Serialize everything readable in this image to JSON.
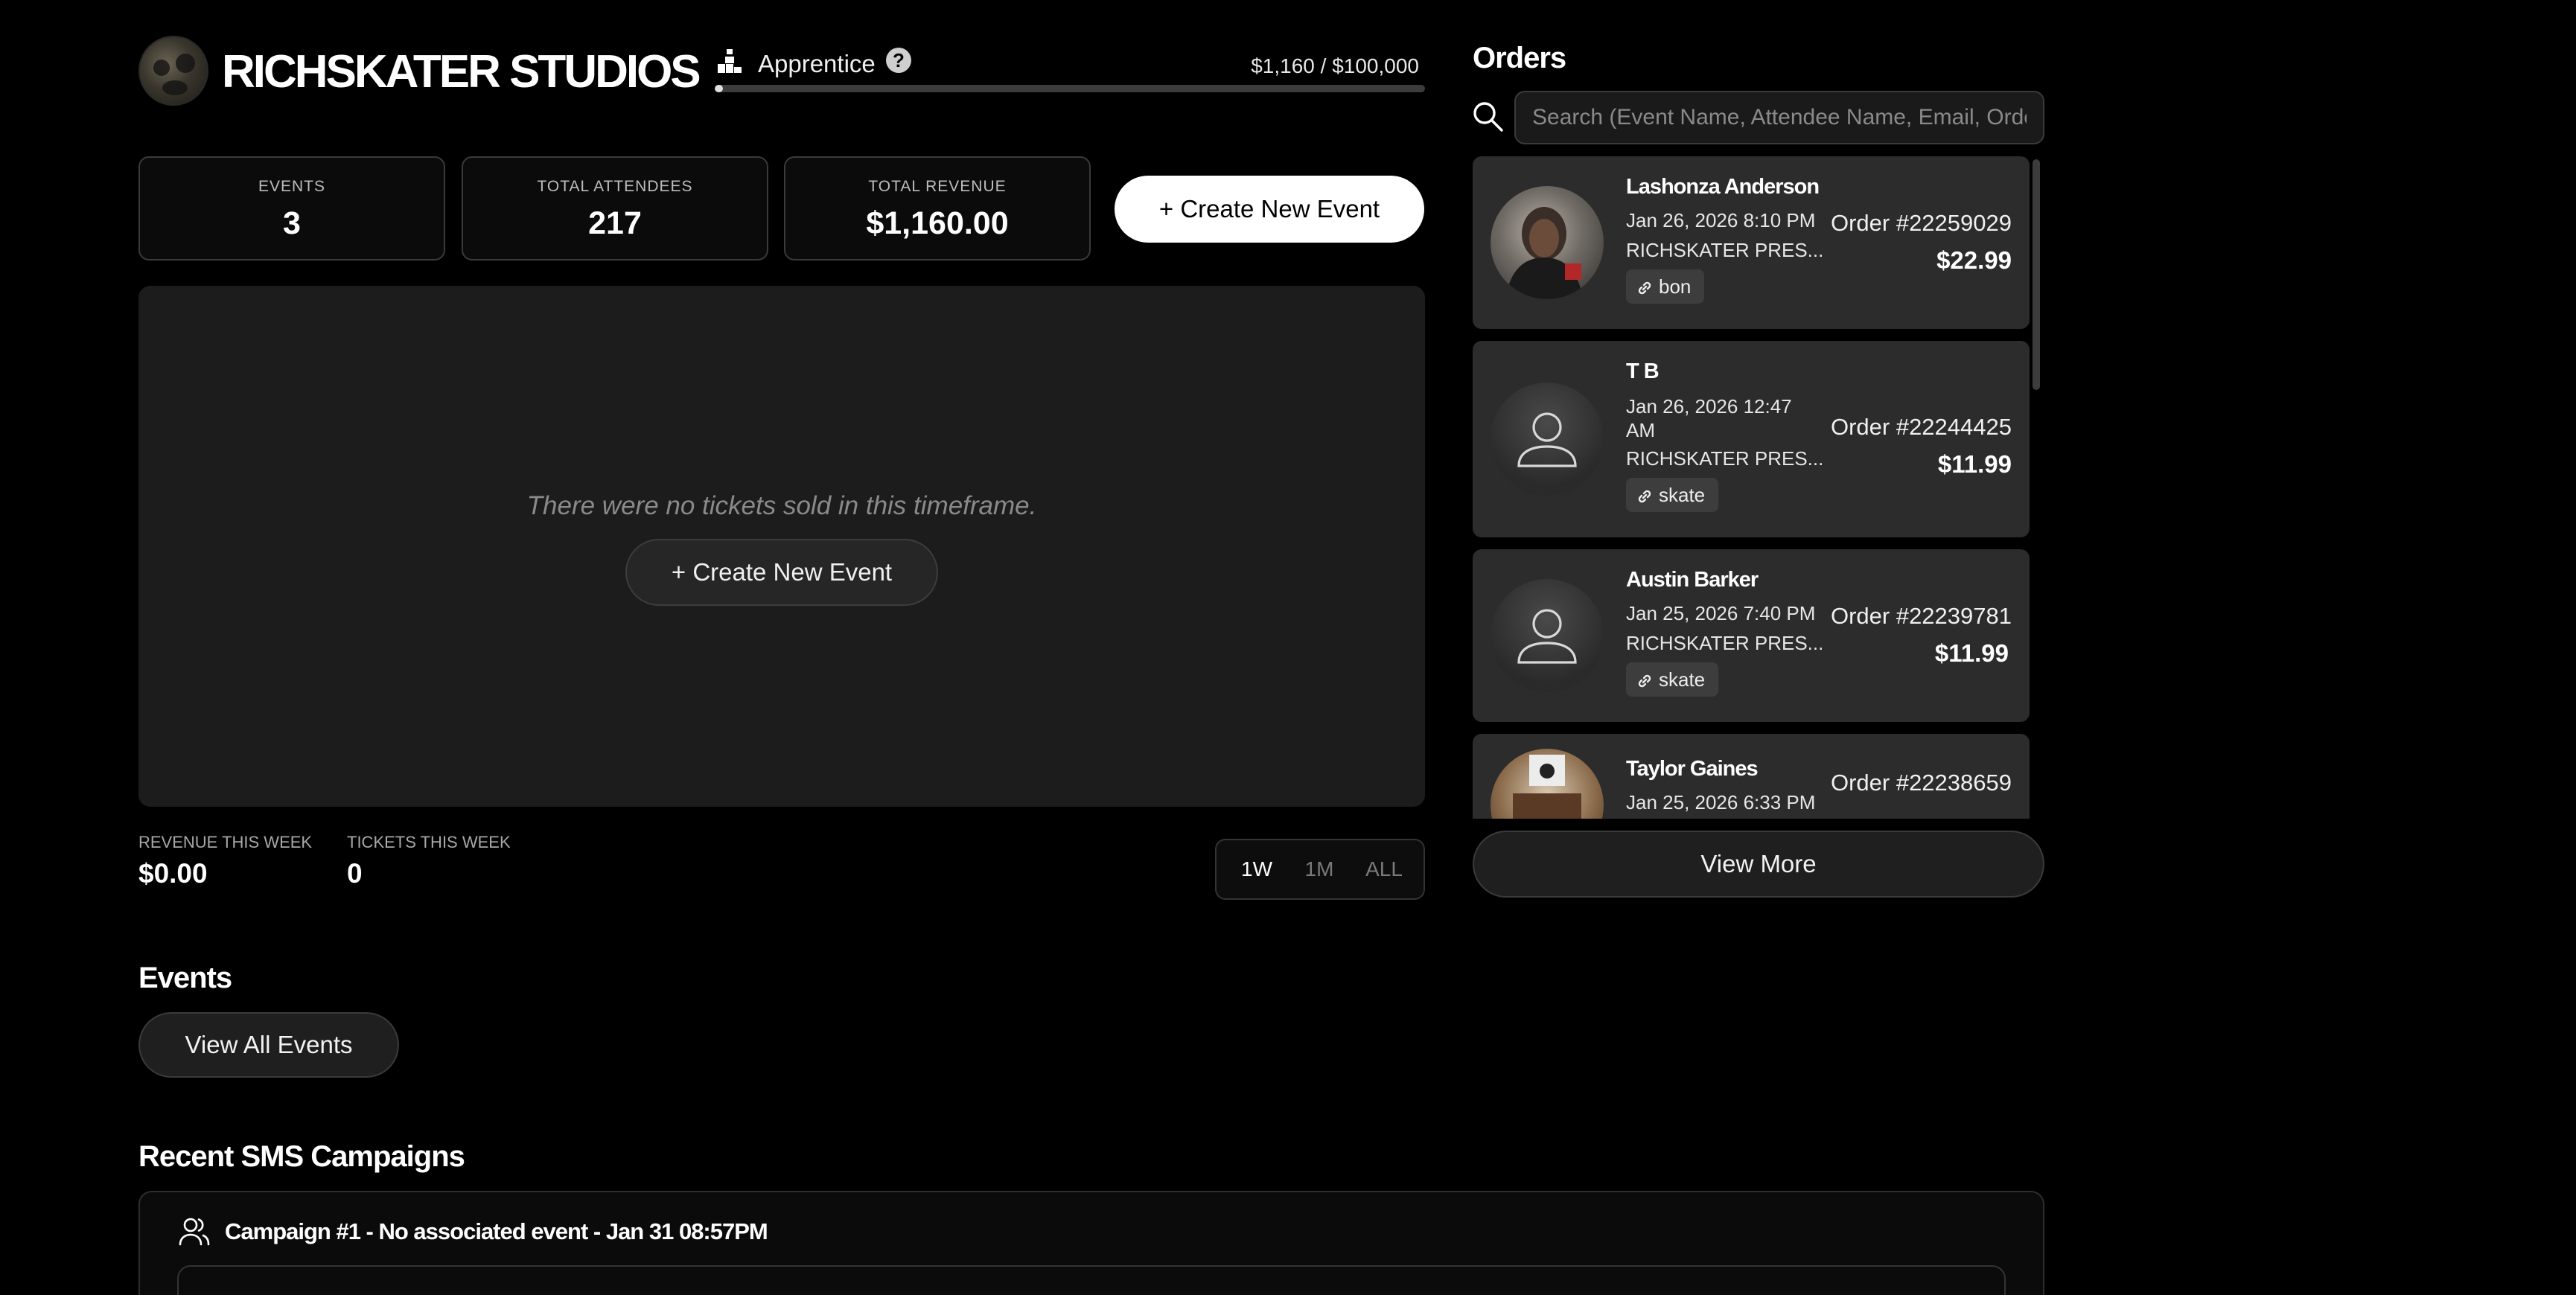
{
  "header": {
    "studio_name": "RICHSKATER STUDIOS",
    "tier_label": "Apprentice",
    "help_glyph": "?",
    "tier_progress_text": "$1,160 / $100,000",
    "tier_progress_fraction": 0.0116
  },
  "stats": {
    "events_label": "EVENTS",
    "events_value": "3",
    "attendees_label": "TOTAL ATTENDEES",
    "attendees_value": "217",
    "revenue_label": "TOTAL REVENUE",
    "revenue_value": "$1,160.00"
  },
  "create_event_label": "+ Create New Event",
  "chart": {
    "empty_message": "There were no tickets sold in this timeframe.",
    "create_event_label": "+ Create New Event"
  },
  "weekly": {
    "revenue_label": "REVENUE THIS WEEK",
    "revenue_value": "$0.00",
    "tickets_label": "TICKETS THIS WEEK",
    "tickets_value": "0"
  },
  "range_options": [
    "1W",
    "1M",
    "ALL"
  ],
  "range_selected": "1W",
  "events_section": {
    "title": "Events",
    "view_all_label": "View All Events"
  },
  "sms_section": {
    "title": "Recent SMS Campaigns",
    "campaign_title": "Campaign #1 - No associated event - Jan 31 08:57PM"
  },
  "orders": {
    "title": "Orders",
    "search_placeholder": "Search (Event Name, Attendee Name, Email, Order #)",
    "view_more_label": "View More",
    "items": [
      {
        "name": "Lashonza Anderson",
        "date": "Jan 26, 2026 8:10 PM",
        "event": "RICHSKATER PRES...",
        "tag": "bon",
        "order_number": "Order #22259029",
        "amount": "$22.99",
        "avatar": "photo"
      },
      {
        "name": "T B",
        "date": "Jan 26, 2026 12:47 AM",
        "event": "RICHSKATER PRES...",
        "tag": "skate",
        "order_number": "Order #22244425",
        "amount": "$11.99",
        "avatar": "default"
      },
      {
        "name": "Austin Barker",
        "date": "Jan 25, 2026 7:40 PM",
        "event": "RICHSKATER PRES...",
        "tag": "skate",
        "order_number": "Order #22239781",
        "amount": "$11.99",
        "avatar": "default"
      },
      {
        "name": "Taylor Gaines",
        "date": "Jan 25, 2026 6:33 PM",
        "event": "",
        "tag": "",
        "order_number": "Order #22238659",
        "amount": "",
        "avatar": "photo"
      }
    ]
  }
}
